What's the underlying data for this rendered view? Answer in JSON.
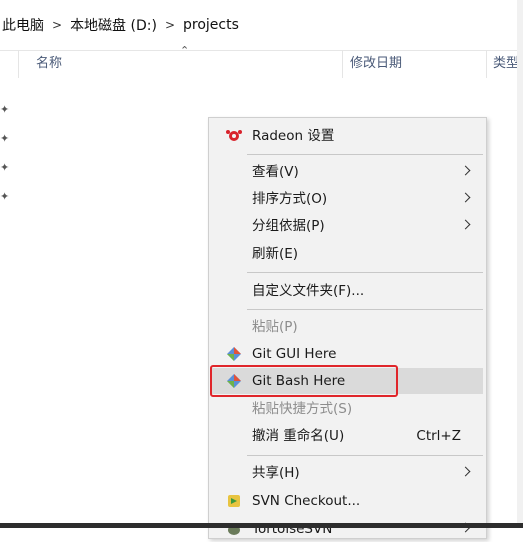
{
  "breadcrumb": {
    "items": [
      "此电脑",
      "本地磁盘 (D:)",
      "projects"
    ]
  },
  "columns": {
    "name": "名称",
    "modified": "修改日期",
    "type": "类型"
  },
  "context_menu": {
    "radeon": "Radeon 设置",
    "view": "查看(V)",
    "sort": "排序方式(O)",
    "group": "分组依据(P)",
    "refresh": "刷新(E)",
    "customize": "自定义文件夹(F)...",
    "paste": "粘贴(P)",
    "git_gui": "Git GUI Here",
    "git_bash": "Git Bash Here",
    "paste_shortcut": "粘贴快捷方式(S)",
    "undo_rename": "撤消 重命名(U)",
    "undo_shortcut": "Ctrl+Z",
    "share": "共享(H)",
    "svn_checkout": "SVN Checkout...",
    "tortoise_svn": "TortoiseSVN"
  },
  "colors": {
    "highlight_border": "#e0262b",
    "menu_background": "#f2f2f2",
    "hover_background": "#dadada"
  }
}
